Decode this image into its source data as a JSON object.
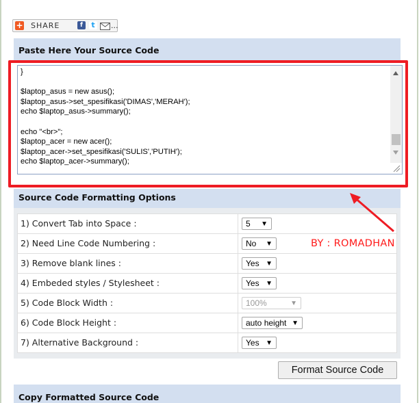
{
  "share": {
    "label": "SHARE",
    "icons": [
      "plus-icon",
      "facebook-icon",
      "twitter-icon",
      "mail-icon",
      "more-icon"
    ],
    "plus_glyph": "+",
    "facebook_glyph": "f",
    "twitter_glyph": "t",
    "more_glyph": "..."
  },
  "paste_section": {
    "title": "Paste Here Your Source Code",
    "code_lines": [
      "}",
      "",
      "$laptop_asus = new asus();",
      "$laptop_asus->set_spesifikasi('DIMAS','MERAH');",
      "echo $laptop_asus->summary();",
      "",
      "echo \"<br>\";",
      "$laptop_acer = new acer();",
      "$laptop_acer->set_spesifikasi('SULIS','PUTIH');",
      "echo $laptop_acer->summary();"
    ]
  },
  "options_section": {
    "title": "Source Code Formatting Options",
    "options": [
      {
        "label": "1) Convert Tab into Space :",
        "value": "5",
        "disabled": false
      },
      {
        "label": "2) Need Line Code Numbering :",
        "value": "No",
        "disabled": false
      },
      {
        "label": "3) Remove blank lines :",
        "value": "Yes",
        "disabled": false
      },
      {
        "label": "4) Embeded styles / Stylesheet :",
        "value": "Yes",
        "disabled": false
      },
      {
        "label": "5) Code Block Width :",
        "value": "100%",
        "disabled": true
      },
      {
        "label": "6) Code Block Height :",
        "value": "auto height",
        "disabled": false
      },
      {
        "label": "7) Alternative Background :",
        "value": "Yes",
        "disabled": false
      }
    ]
  },
  "annotation": {
    "text": "BY : ROMADHAN",
    "color": "#ff1a1a"
  },
  "format_button": {
    "label": "Format Source Code"
  },
  "copy_section": {
    "title": "Copy Formatted Source Code"
  },
  "colors": {
    "highlight_red": "#ee1c24",
    "section_bar": "#d3dff0",
    "section_rule": "#22419b"
  }
}
